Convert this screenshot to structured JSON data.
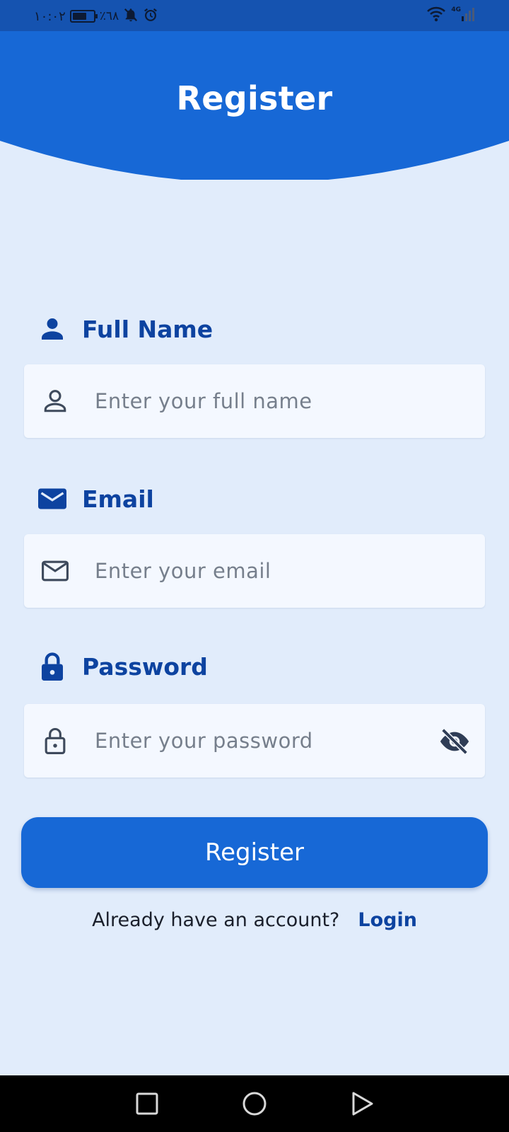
{
  "status_bar": {
    "time": "١٠:٠٢",
    "battery_percent": "٪٦٨",
    "battery_level": 0.68,
    "network_type": "4G",
    "icons": [
      "battery-icon",
      "bell-off-icon",
      "alarm-icon",
      "wifi-icon",
      "signal-icon"
    ]
  },
  "header": {
    "title": "Register"
  },
  "form": {
    "full_name": {
      "label": "Full Name",
      "placeholder": "Enter your full name",
      "value": "",
      "label_icon": "person-filled-icon",
      "field_icon": "person-outline-icon"
    },
    "email": {
      "label": "Email",
      "placeholder": "Enter your email",
      "value": "",
      "label_icon": "mail-filled-icon",
      "field_icon": "mail-outline-icon"
    },
    "password": {
      "label": "Password",
      "placeholder": "Enter your password",
      "value": "",
      "label_icon": "lock-filled-icon",
      "field_icon": "lock-outline-icon",
      "toggle_icon": "eye-off-icon"
    },
    "submit_label": "Register"
  },
  "footer": {
    "prompt": "Already have an account?",
    "login_label": "Login"
  },
  "nav_bar": {
    "icons": [
      "recents-square-icon",
      "home-circle-icon",
      "back-triangle-icon"
    ]
  },
  "colors": {
    "primary": "#1768d6",
    "header_dark": "#1553b0",
    "label": "#0d43a0",
    "background": "#e1ecfb",
    "input_bg": "#f4f8ff"
  }
}
